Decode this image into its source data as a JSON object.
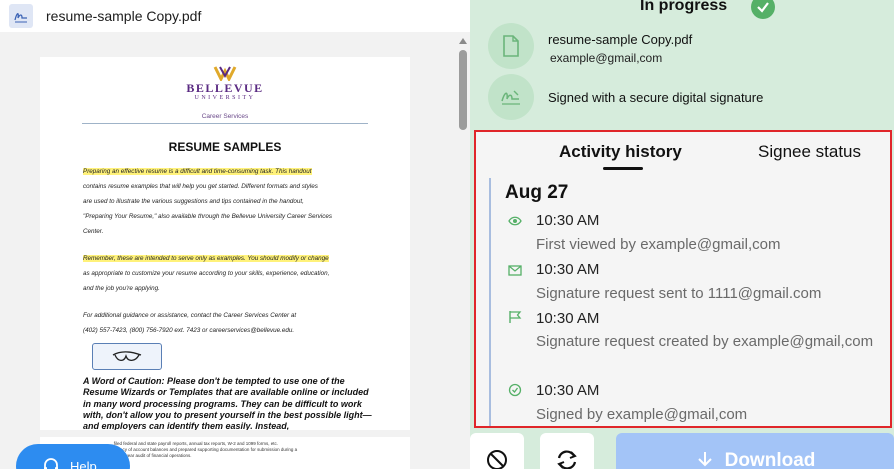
{
  "file": {
    "name": "resume-sample Copy.pdf"
  },
  "document_page": {
    "brand": "BELLEVUE",
    "brand_sub": "UNIVERSITY",
    "department": "Career Services",
    "title": "RESUME SAMPLES",
    "para1": [
      "Preparing an effective resume is a difficult and time-consuming task.  This handout",
      "contains resume examples that will help you get started.  Different formats and styles",
      "are used to illustrate the various suggestions and tips contained in the handout,",
      "\"Preparing Your Resume,\" also available through the Bellevue University Career Services",
      "Center."
    ],
    "para2": [
      "Remember, these are intended to serve only as examples.  You should modify or change",
      "as appropriate to customize your resume according to your skills, experience, education,",
      "and the job you're applying."
    ],
    "para3": [
      "For additional guidance or assistance, contact the Career Services Center at",
      "(402) 557-7423, (800) 756-7920 ext. 7423 or careerservices@bellevue.edu."
    ],
    "caution": "A Word of Caution: Please don't be tempted to use one of the Resume Wizards or Templates that are available online or included in many word processing programs.  They can be difficult to work with, don't allow you to present yourself in the best possible light—and employers can identify them easily. Instead,",
    "next_page_lines": [
      "...filed federal and state payroll reports, annual tax reports, W-2 and 1099 forms, etc.",
      "...curacy of account balances and prepared supporting documentation for submission during a",
      "...three-year audit of financial operations."
    ]
  },
  "help": {
    "label": "Help"
  },
  "status": {
    "label": "In progress",
    "accent": "#55b067"
  },
  "document_info": {
    "file_name": "resume-sample Copy.pdf",
    "email": "example@gmail,com"
  },
  "signature_info": {
    "label": "Signed with a secure digital signature"
  },
  "activity_panel": {
    "tabs": [
      {
        "label": "Activity history"
      },
      {
        "label": "Signee status"
      }
    ],
    "date": "Aug 27",
    "events": [
      {
        "icon": "eye-icon",
        "time": "10:30 AM",
        "description": "First viewed by example@gmail,com"
      },
      {
        "icon": "mail-icon",
        "time": "10:30 AM",
        "description": "Signature request sent to 1111@gmail.com"
      },
      {
        "icon": "flag-icon",
        "time": "10:30 AM",
        "description": "Signature request created by example@gmail,com"
      },
      {
        "icon": "check-circle-icon",
        "time": "10:30 AM",
        "description": "Signed by example@gmail,com"
      }
    ]
  },
  "actions": {
    "download_label": "Download"
  },
  "colors": {
    "panel_bg": "#d6ecdc",
    "highlight_border": "#e0262a",
    "download_bg": "#a3c4f7",
    "help_bg": "#2d8cf0"
  }
}
